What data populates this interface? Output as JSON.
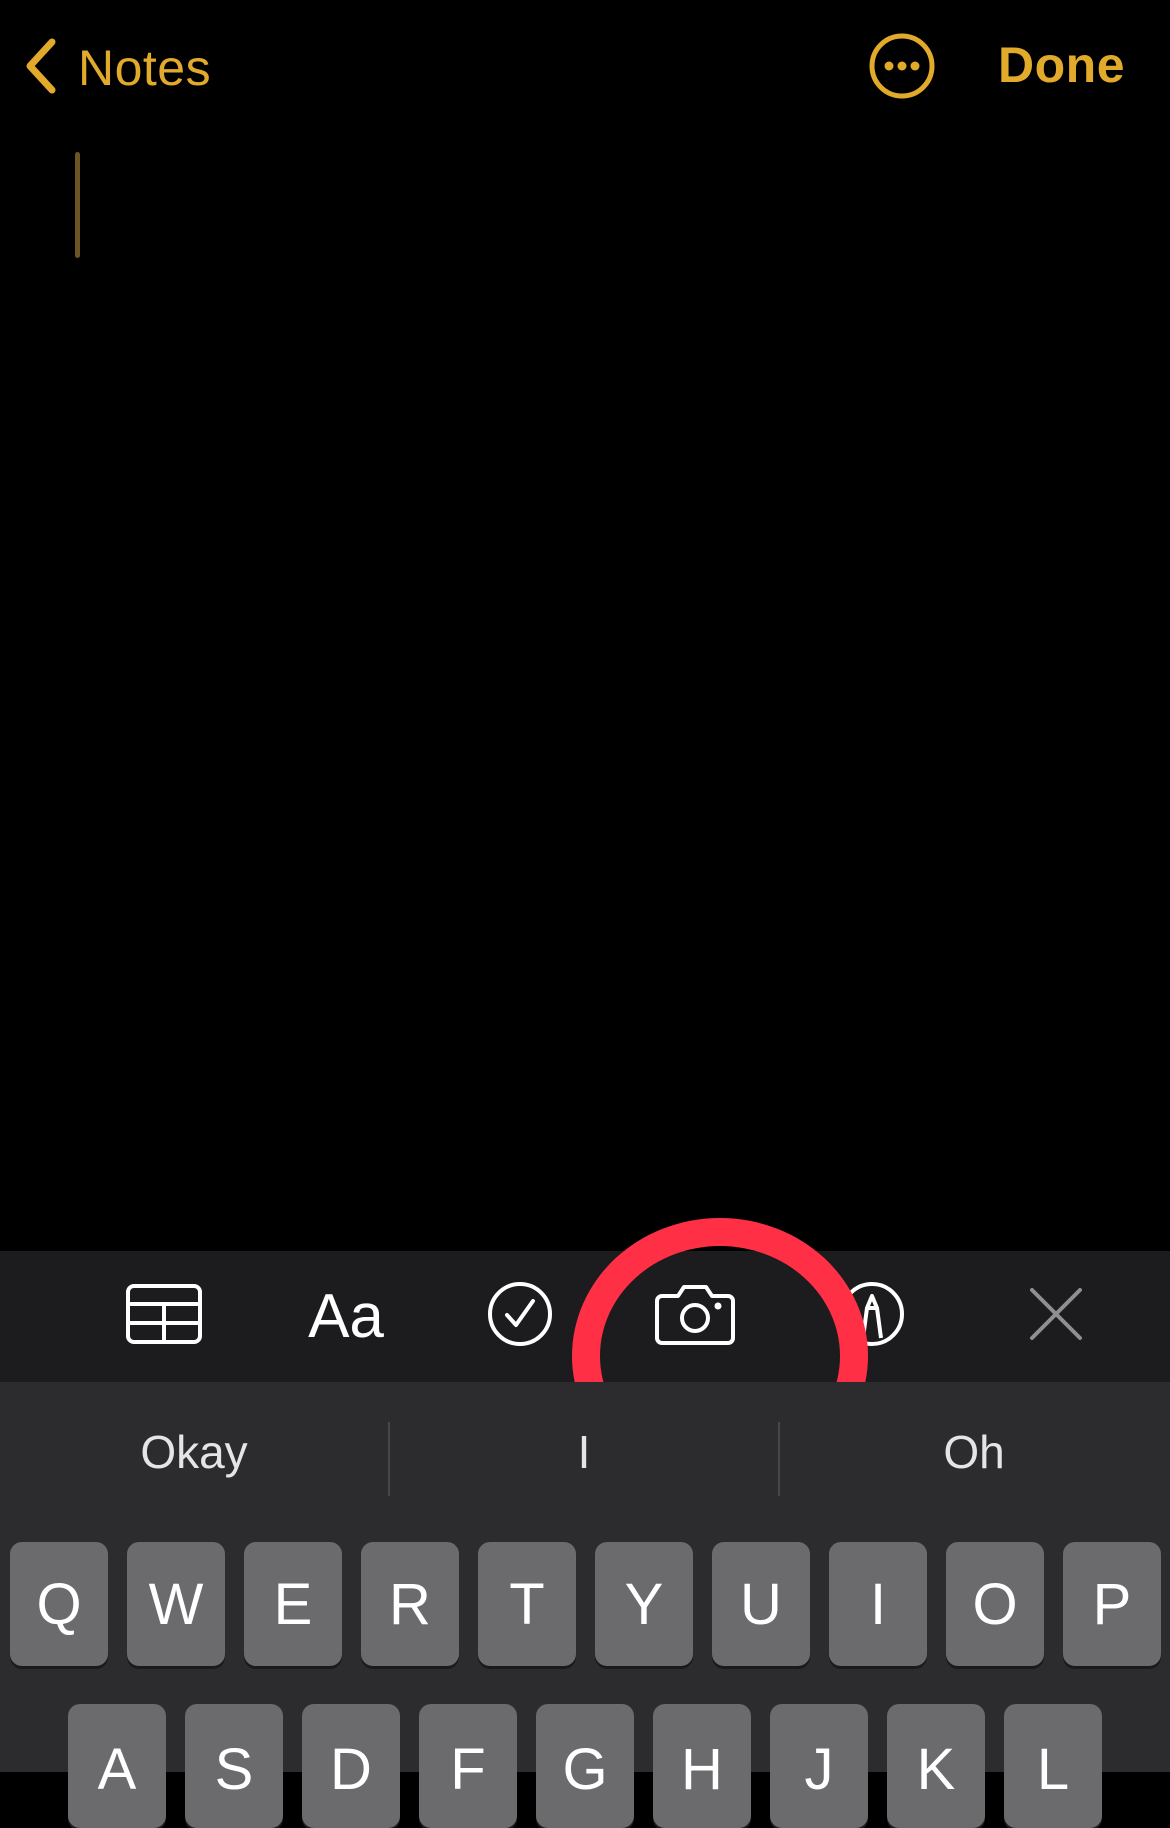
{
  "nav": {
    "back_label": "Notes",
    "done_label": "Done",
    "accent_color": "#E1AA2B"
  },
  "toolbar": {
    "format_label": "Aa",
    "icons": [
      "table-icon",
      "format-text-icon",
      "checklist-icon",
      "camera-icon",
      "markup-icon",
      "close-icon"
    ]
  },
  "suggestions": [
    "Okay",
    "I",
    "Oh"
  ],
  "keyboard": {
    "row1": [
      "Q",
      "W",
      "E",
      "R",
      "T",
      "Y",
      "U",
      "I",
      "O",
      "P"
    ],
    "row2": [
      "A",
      "S",
      "D",
      "F",
      "G",
      "H",
      "J",
      "K",
      "L"
    ]
  },
  "annotation": {
    "color": "#FF3045",
    "target": "camera-icon"
  }
}
